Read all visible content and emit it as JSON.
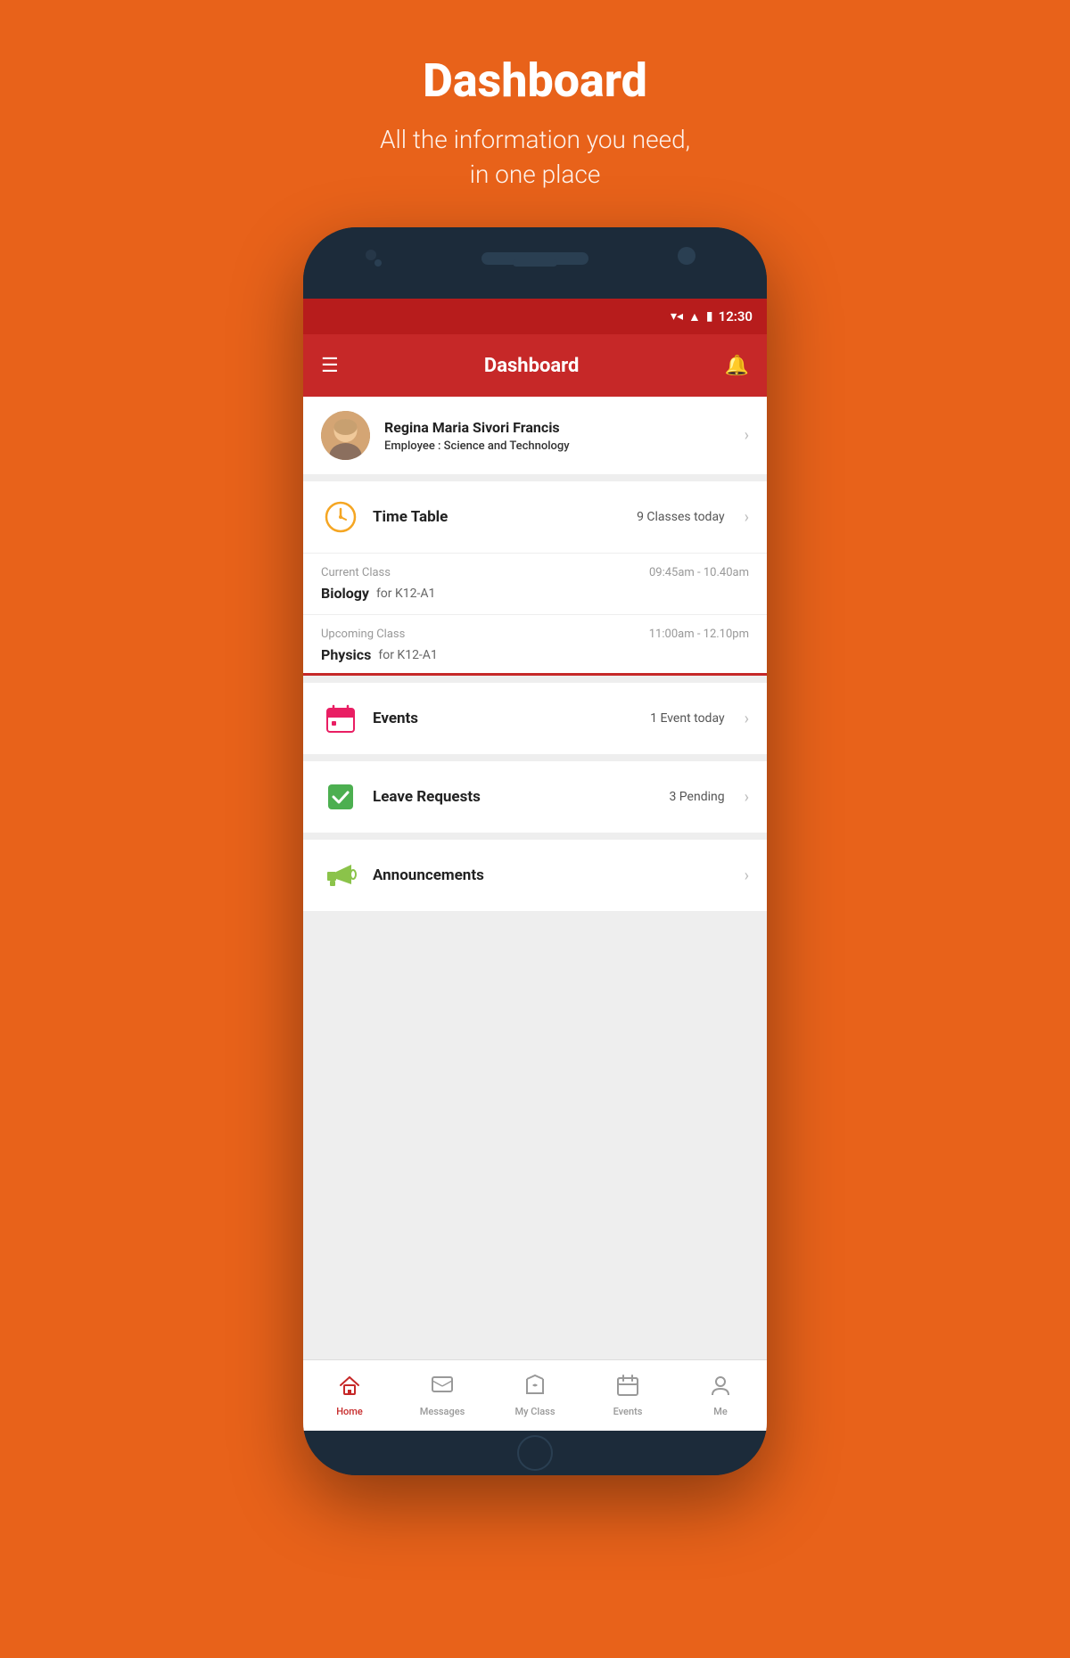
{
  "page": {
    "title": "Dashboard",
    "subtitle_line1": "All the information you need,",
    "subtitle_line2": "in one place"
  },
  "status_bar": {
    "time": "12:30"
  },
  "app_bar": {
    "title": "Dashboard",
    "menu_icon": "☰",
    "bell_icon": "🔔"
  },
  "user": {
    "name": "Regina Maria Sivori Francis",
    "role_label": "Employee : ",
    "role_value": "Science and Technology",
    "avatar_emoji": "👩"
  },
  "sections": [
    {
      "id": "timetable",
      "icon": "⏰",
      "icon_color": "#f5a623",
      "title": "Time Table",
      "badge": "9 Classes today",
      "has_details": true,
      "details": [
        {
          "label": "Current Class",
          "time": "09:45am - 10.40am",
          "subject": "Biology",
          "group": "for K12-A1"
        },
        {
          "label": "Upcoming Class",
          "time": "11:00am - 12.10pm",
          "subject": "Physics",
          "group": "for K12-A1"
        }
      ]
    },
    {
      "id": "events",
      "icon": "📅",
      "icon_color": "#e91e63",
      "title": "Events",
      "badge": "1 Event today",
      "has_details": false
    },
    {
      "id": "leave",
      "icon": "✅",
      "icon_color": "#4caf50",
      "title": "Leave Requests",
      "badge": "3 Pending",
      "has_details": false
    },
    {
      "id": "announcements",
      "icon": "📢",
      "icon_color": "#8bc34a",
      "title": "Announcements",
      "badge": "",
      "has_details": false
    }
  ],
  "bottom_nav": [
    {
      "id": "home",
      "label": "Home",
      "icon": "🏠",
      "active": true
    },
    {
      "id": "messages",
      "label": "Messages",
      "icon": "💬",
      "active": false
    },
    {
      "id": "myclass",
      "label": "My Class",
      "icon": "📖",
      "active": false
    },
    {
      "id": "events",
      "label": "Events",
      "icon": "📅",
      "active": false
    },
    {
      "id": "me",
      "label": "Me",
      "icon": "👤",
      "active": false
    }
  ]
}
